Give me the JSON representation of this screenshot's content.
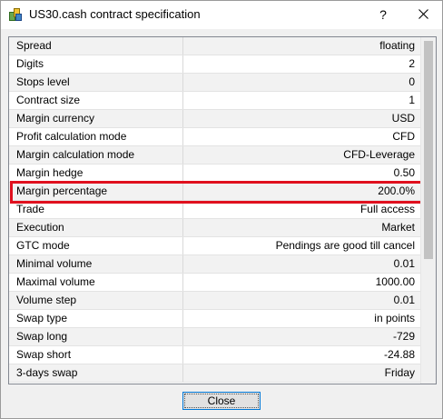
{
  "window": {
    "title": "US30.cash contract specification",
    "help_label": "?",
    "icon": "app-icon",
    "close_icon": "close-icon"
  },
  "spec": {
    "rows": [
      {
        "name": "Spread",
        "value": "floating"
      },
      {
        "name": "Digits",
        "value": "2"
      },
      {
        "name": "Stops level",
        "value": "0"
      },
      {
        "name": "Contract size",
        "value": "1"
      },
      {
        "name": "Margin currency",
        "value": "USD"
      },
      {
        "name": "Profit calculation mode",
        "value": "CFD"
      },
      {
        "name": "Margin calculation mode",
        "value": "CFD-Leverage"
      },
      {
        "name": "Margin hedge",
        "value": "0.50"
      },
      {
        "name": "Margin percentage",
        "value": "200.0%"
      },
      {
        "name": "Trade",
        "value": "Full access"
      },
      {
        "name": "Execution",
        "value": "Market"
      },
      {
        "name": "GTC mode",
        "value": "Pendings are good till cancel"
      },
      {
        "name": "Minimal volume",
        "value": "0.01"
      },
      {
        "name": "Maximal volume",
        "value": "1000.00"
      },
      {
        "name": "Volume step",
        "value": "0.01"
      },
      {
        "name": "Swap type",
        "value": "in points"
      },
      {
        "name": "Swap long",
        "value": "-729"
      },
      {
        "name": "Swap short",
        "value": "-24.88"
      },
      {
        "name": "3-days swap",
        "value": "Friday"
      }
    ],
    "highlighted_row": "Margin percentage",
    "highlight_color": "#e0101e"
  },
  "footer": {
    "close_label": "Close"
  },
  "colors": {
    "row_alt": "#f2f2f2",
    "button_focus": "#0078d7"
  }
}
